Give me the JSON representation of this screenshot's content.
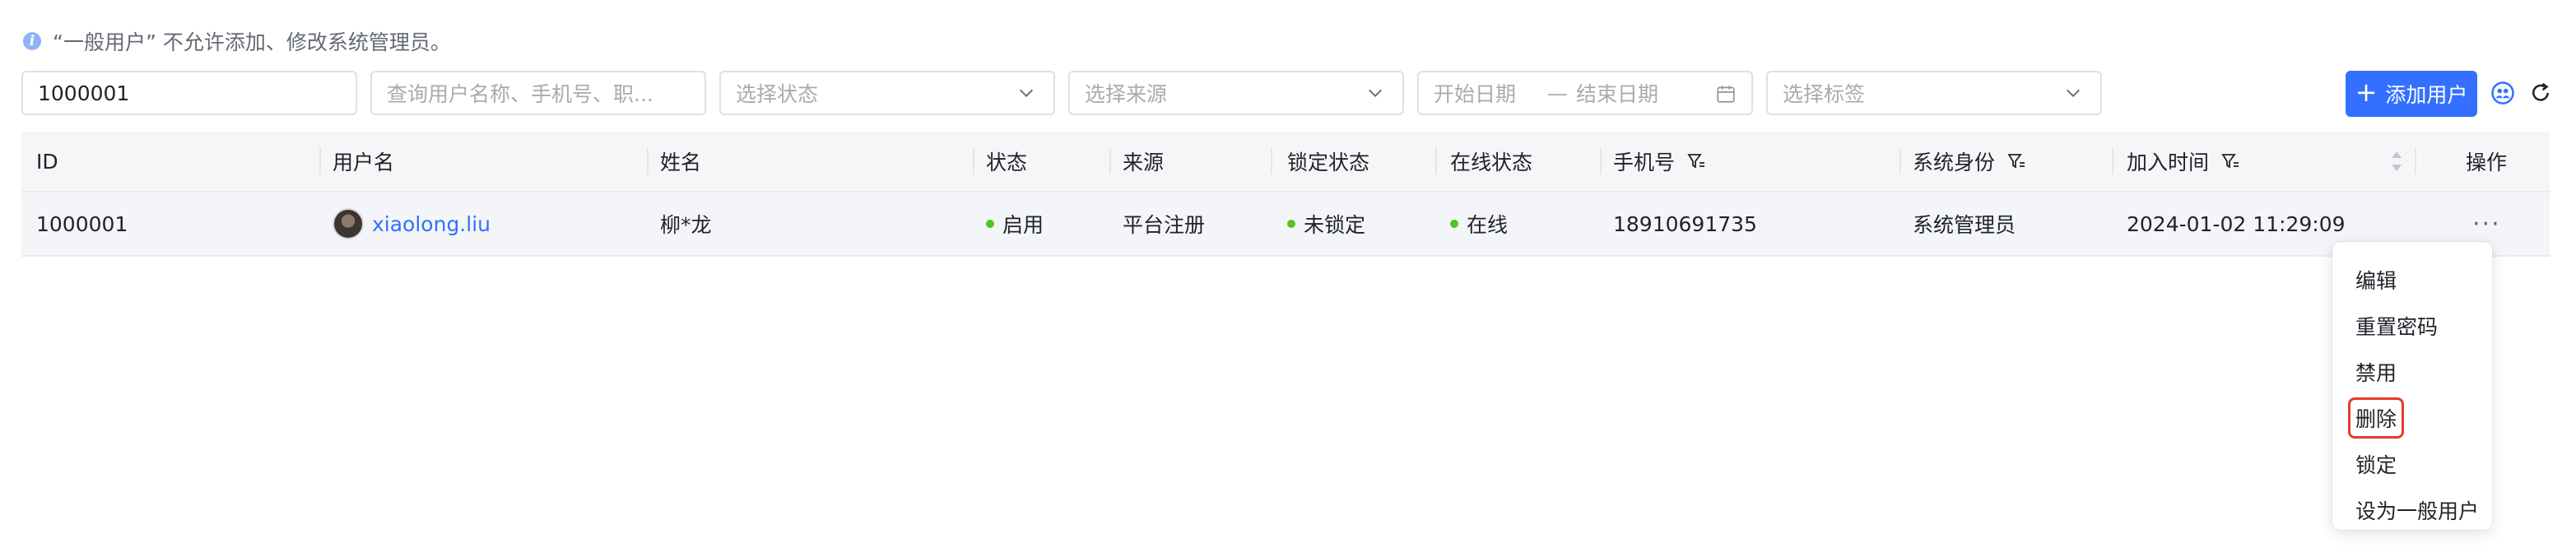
{
  "notice": {
    "text": "“一般用户” 不允许添加、修改系统管理员。"
  },
  "filters": {
    "id_value": "1000001",
    "search_placeholder": "查询用户名称、手机号、职...",
    "status_placeholder": "选择状态",
    "source_placeholder": "选择来源",
    "start_date_placeholder": "开始日期",
    "date_separator": "—",
    "end_date_placeholder": "结束日期",
    "tag_placeholder": "选择标签"
  },
  "toolbar": {
    "add_user_label": "添加用户"
  },
  "table": {
    "columns": [
      "ID",
      "用户名",
      "姓名",
      "状态",
      "来源",
      "锁定状态",
      "在线状态",
      "手机号",
      "系统身份",
      "加入时间",
      "操作"
    ],
    "rows": [
      {
        "id": "1000001",
        "username": "xiaolong.liu",
        "name": "柳*龙",
        "status": "启用",
        "source": "平台注册",
        "lock_status": "未锁定",
        "online_status": "在线",
        "phone": "18910691735",
        "system_role": "系统管理员",
        "joined_at": "2024-01-02 11:29:09",
        "actions": "···"
      }
    ]
  },
  "action_menu": {
    "items": [
      "编辑",
      "重置密码",
      "禁用",
      "删除",
      "锁定",
      "设为一般用户"
    ],
    "highlighted_item": "删除"
  },
  "colors": {
    "primary": "#3370ff",
    "highlight": "#e63a2e",
    "status_green": "#52c41a"
  }
}
